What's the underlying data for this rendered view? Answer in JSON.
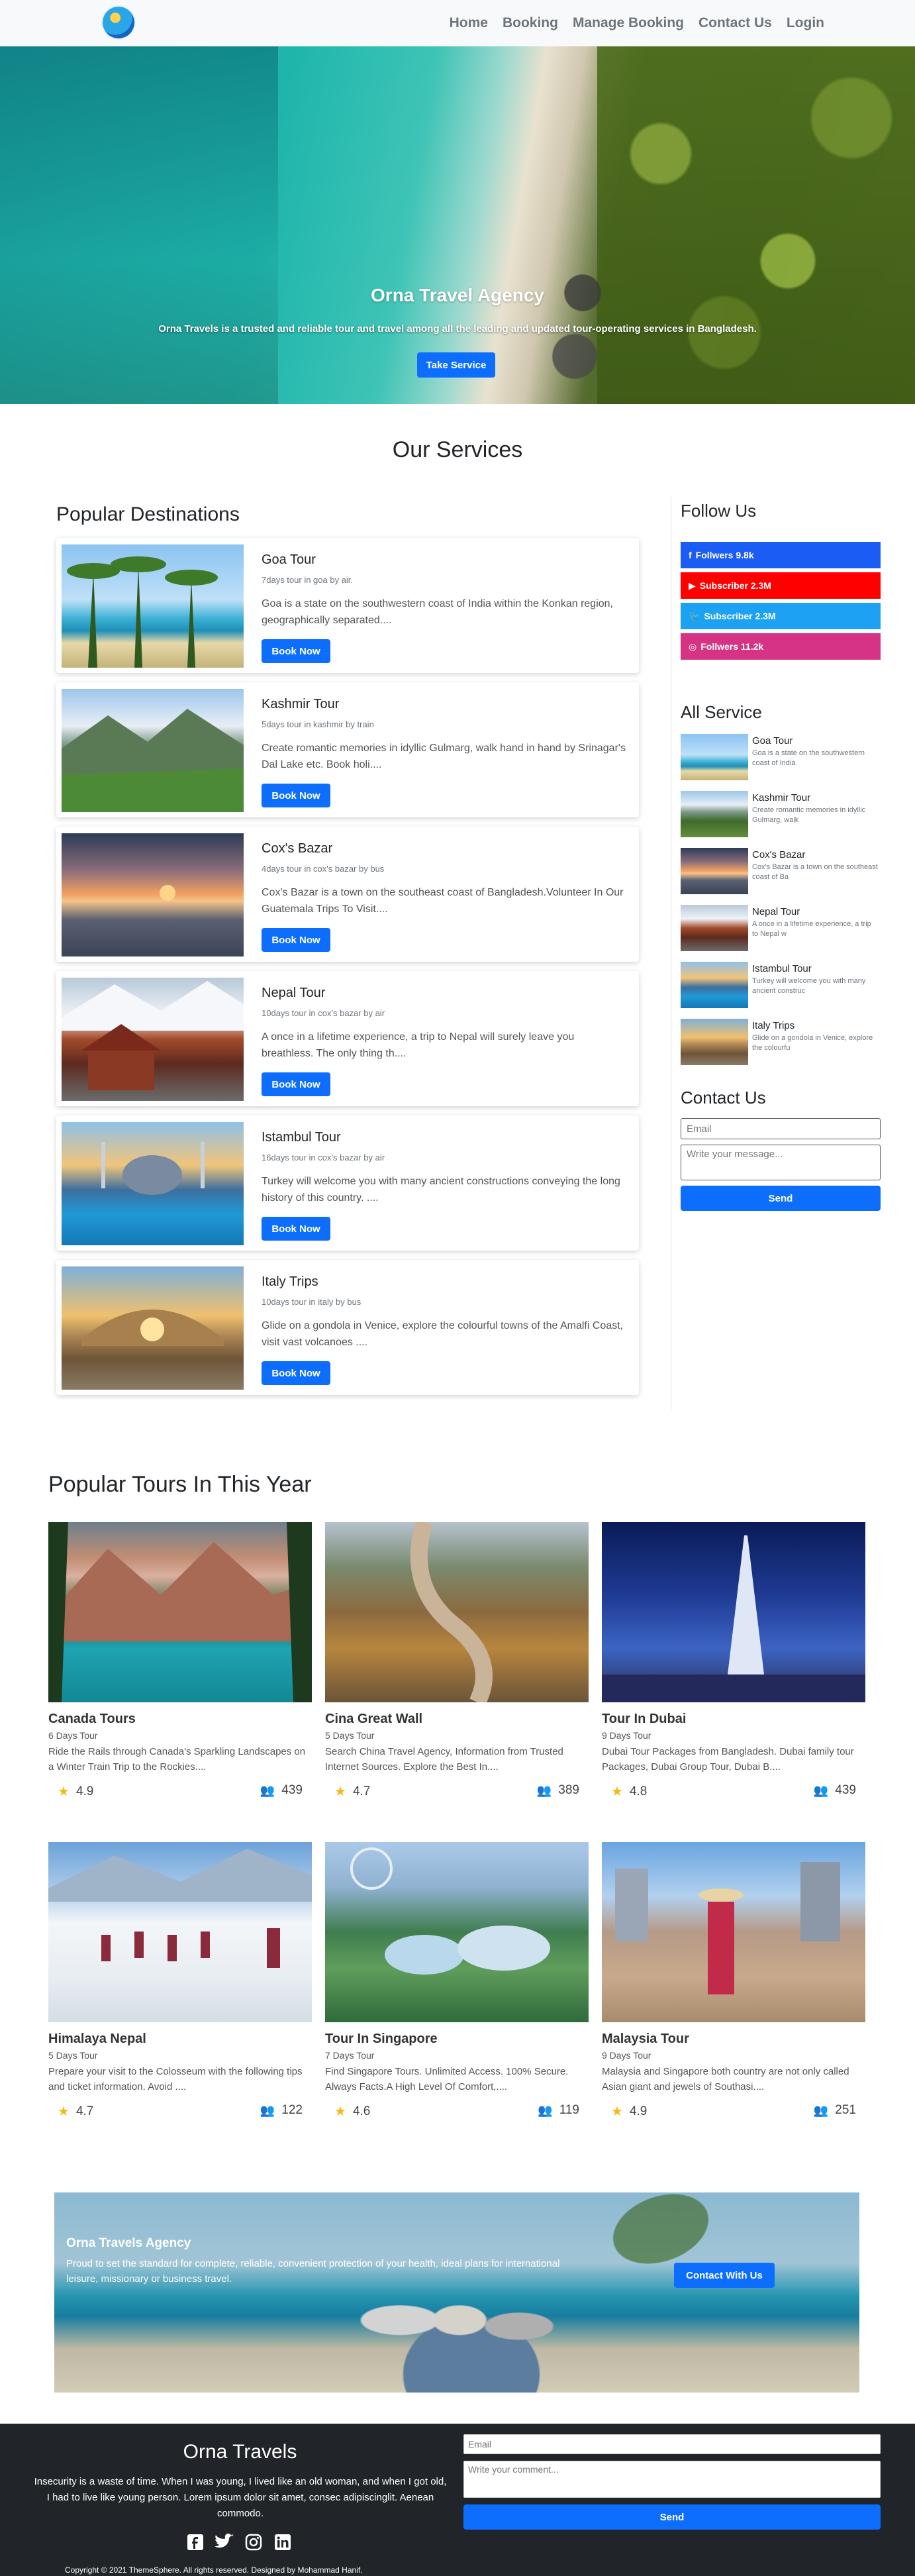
{
  "nav": {
    "links": [
      "Home",
      "Booking",
      "Manage Booking",
      "Contact Us",
      "Login"
    ]
  },
  "hero": {
    "title": "Orna Travel Agency",
    "subtitle": "Orna Travels is a trusted and reliable tour and travel among all the leading and updated tour-operating services in Bangladesh.",
    "button": "Take Service"
  },
  "services": {
    "title": "Our Services",
    "destinations_title": "Popular Destinations",
    "destinations": [
      {
        "title": "Goa Tour",
        "meta": "7days tour in goa by air.",
        "desc": "Goa is a state on the southwestern coast of India within the Konkan region, geographically separated....",
        "button": "Book Now"
      },
      {
        "title": "Kashmir Tour",
        "meta": "5days tour in kashmir by train",
        "desc": "Create romantic memories in idyllic Gulmarg, walk hand in hand by Srinagar's Dal Lake etc. Book holi....",
        "button": "Book Now"
      },
      {
        "title": "Cox's Bazar",
        "meta": "4days tour in cox's bazar by bus",
        "desc": "Cox's Bazar is a town on the southeast coast of Bangladesh.Volunteer In Our Guatemala Trips To Visit....",
        "button": "Book Now"
      },
      {
        "title": "Nepal Tour",
        "meta": "10days tour in cox's bazar by air",
        "desc": "A once in a lifetime experience, a trip to Nepal will surely leave you breathless. The only thing th....",
        "button": "Book Now"
      },
      {
        "title": "Istambul Tour",
        "meta": "16days tour in cox's bazar by air",
        "desc": "Turkey will welcome you with many ancient constructions conveying the long history of this country. ....",
        "button": "Book Now"
      },
      {
        "title": "Italy Trips",
        "meta": "10days tour in italy by bus",
        "desc": "Glide on a gondola in Venice, explore the colourful towns of the Amalfi Coast, visit vast volcanoes ....",
        "button": "Book Now"
      }
    ]
  },
  "sidebar": {
    "follow_title": "Follow Us",
    "social": [
      {
        "icon": "facebook-icon",
        "glyph": "f",
        "label": "Follwers 9.8k",
        "color": "#1b5cf5"
      },
      {
        "icon": "youtube-icon",
        "glyph": "▶",
        "label": "Subscriber 2.3M",
        "color": "#ff0000"
      },
      {
        "icon": "twitter-icon",
        "glyph": "🐦",
        "label": "Subscriber 2.3M",
        "color": "#1da1f2"
      },
      {
        "icon": "instagram-icon",
        "glyph": "◎",
        "label": "Follwers 11.2k",
        "color": "#d63384"
      }
    ],
    "services_title": "All Service",
    "services": [
      {
        "title": "Goa Tour",
        "desc": "Goa is a state on the southwestern coast of India"
      },
      {
        "title": "Kashmir Tour",
        "desc": "Create romantic memories in idyllic Gulmarg, walk"
      },
      {
        "title": "Cox's Bazar",
        "desc": "Cox's Bazar is a town on the southeast coast of Ba"
      },
      {
        "title": "Nepal Tour",
        "desc": "A once in a lifetime experience, a trip to Nepal w"
      },
      {
        "title": "Istambul Tour",
        "desc": "Turkey will welcome you with many ancient construc"
      },
      {
        "title": "Italy Trips",
        "desc": "Glide on a gondola in Venice, explore the colourfu"
      }
    ],
    "contact_title": "Contact Us",
    "email_placeholder": "Email",
    "message_placeholder": "Write your message...",
    "send": "Send"
  },
  "tours": {
    "title": "Popular Tours In This Year",
    "items": [
      {
        "title": "Canada Tours",
        "days": "6 Days Tour",
        "desc": "Ride the Rails through Canada's Sparkling Landscapes on a Winter Train Trip to the Rockies....",
        "rating": "4.9",
        "count": "439"
      },
      {
        "title": "Cina Great Wall",
        "days": "5 Days Tour",
        "desc": "Search China Travel Agency, Information from Trusted Internet Sources. Explore the Best In....",
        "rating": "4.7",
        "count": "389"
      },
      {
        "title": "Tour In Dubai",
        "days": "9 Days Tour",
        "desc": "Dubai Tour Packages from Bangladesh. Dubai family tour Packages, Dubai Group Tour, Dubai B....",
        "rating": "4.8",
        "count": "439"
      },
      {
        "title": "Himalaya Nepal",
        "days": "5 Days Tour",
        "desc": "Prepare your visit to the Colosseum with the following tips and ticket information. Avoid ....",
        "rating": "4.7",
        "count": "122"
      },
      {
        "title": "Tour In Singapore",
        "days": "7 Days Tour",
        "desc": "Find Singapore Tours. Unlimited Access. 100% Secure. Always Facts.A High Level Of Comfort,....",
        "rating": "4.6",
        "count": "119"
      },
      {
        "title": "Malaysia Tour",
        "days": "9 Days Tour",
        "desc": "Malaysia and Singapore both country are not only called Asian giant and jewels of Southasi....",
        "rating": "4.9",
        "count": "251"
      }
    ]
  },
  "banner": {
    "title": "Orna Travels Agency",
    "text": "Proud to set the standard for complete, reliable, convenient protection of your health, ideal plans for international leisure, missionary or business travel.",
    "button": "Contact With Us"
  },
  "footer": {
    "brand": "Orna Travels",
    "text": "Insecurity is a waste of time. When I was young, I lived like an old woman, and when I got old, I had to live like young person. Lorem ipsum dolor sit amet, consec adipiscinglit. Aenean commodo.",
    "email_placeholder": "Email",
    "comment_placeholder": "Write your comment...",
    "send": "Send",
    "copyright": "Copyright © 2021 ThemeSphere. All rights reserved. Designed by Mohammad Hanif."
  },
  "colors": {
    "primary": "#0d6efd",
    "footer_bg": "#212529",
    "star": "#f5b914"
  }
}
